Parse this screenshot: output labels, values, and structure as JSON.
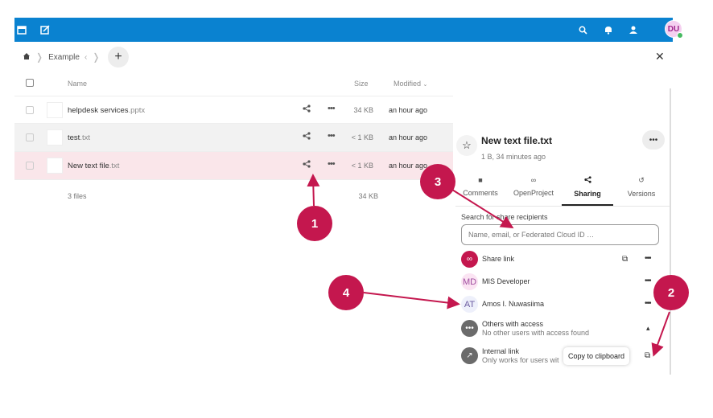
{
  "topbar": {
    "icons": [
      "calendar-icon",
      "notes-icon",
      "search-icon",
      "notifications-icon",
      "contacts-icon"
    ],
    "avatar_initials": "DU"
  },
  "breadcrumb": {
    "home_icon": "home-icon",
    "folder": "Example"
  },
  "file_list": {
    "headers": {
      "name": "Name",
      "size": "Size",
      "modified": "Modified"
    },
    "rows": [
      {
        "name": "helpdesk services",
        "ext": ".pptx",
        "size": "34 KB",
        "modified": "an hour ago"
      },
      {
        "name": "test",
        "ext": ".txt",
        "size": "< 1 KB",
        "modified": "an hour ago"
      },
      {
        "name": "New text file",
        "ext": ".txt",
        "size": "< 1 KB",
        "modified": "an hour ago"
      }
    ],
    "summary": {
      "count": "3 files",
      "size": "34 KB"
    }
  },
  "sidebar": {
    "title": "New text file.txt",
    "subtitle": "1 B, 34 minutes ago",
    "tabs": [
      {
        "label": "Comments",
        "icon": "comment-icon"
      },
      {
        "label": "OpenProject",
        "icon": "link-icon"
      },
      {
        "label": "Sharing",
        "icon": "share-icon"
      },
      {
        "label": "Versions",
        "icon": "history-icon"
      }
    ],
    "search_label": "Search for share recipients",
    "search_placeholder": "Name, email, or Federated Cloud ID …",
    "shares": {
      "share_link": "Share link",
      "mis_initials": "MD",
      "mis_name": "MIS Developer",
      "amos_initials": "AT",
      "amos_name": "Amos I. Nuwasiima",
      "others_title": "Others with access",
      "others_sub": "No other users with access found",
      "internal_title": "Internal link",
      "internal_sub": "Only works for users wit"
    },
    "tooltip": "Copy to clipboard"
  },
  "annotations": {
    "b1": "1",
    "b2": "2",
    "b3": "3",
    "b4": "4"
  },
  "colors": {
    "topbar": "#0a82d0",
    "selected_row": "#fae6ea",
    "badge": "#c4174e"
  }
}
